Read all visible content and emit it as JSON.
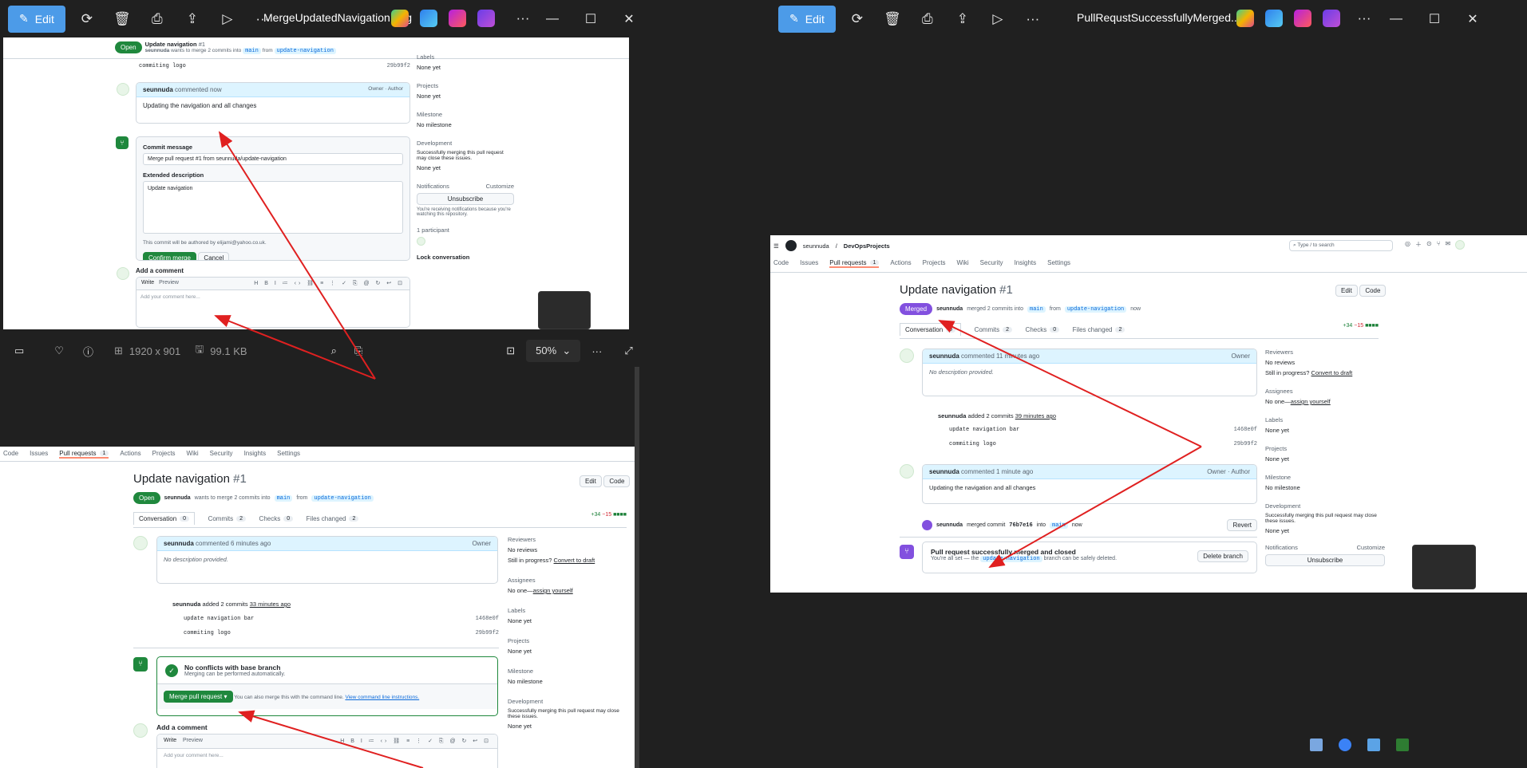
{
  "left_window": {
    "edit_label": "Edit",
    "filename": "MergeUpdatedNavigation.png",
    "dimensions": "1920 x 901",
    "filesize": "99.1 KB",
    "zoom": "50%"
  },
  "right_window": {
    "edit_label": "Edit",
    "filename": "PullRequstSuccessfullyMerged...."
  },
  "pr": {
    "title": "Update navigation",
    "number": "#1",
    "open_badge": "Open",
    "merged_badge": "Merged",
    "user": "seunnuda",
    "wants_text": "wants to merge 2 commits into",
    "merged_text": "merged 2 commits into",
    "base": "main",
    "from": "from",
    "head": "update-navigation",
    "now": "now",
    "repo": "DevOpsProjects",
    "search_placeholder": "Type / to search"
  },
  "nav": {
    "code": "Code",
    "issues": "Issues",
    "pulls": "Pull requests",
    "pulls_count": "1",
    "actions": "Actions",
    "projects": "Projects",
    "wiki": "Wiki",
    "security": "Security",
    "insights": "Insights",
    "settings": "Settings"
  },
  "tabs": {
    "conversation": "Conversation",
    "conv_count": "0",
    "commits": "Commits",
    "commits_count": "2",
    "checks": "Checks",
    "checks_count": "0",
    "files": "Files changed",
    "files_count": "2",
    "diff_add": "+34",
    "diff_del": "−15"
  },
  "buttons": {
    "edit": "Edit",
    "code": "Code",
    "confirm_merge": "Confirm merge",
    "cancel": "Cancel",
    "merge_pr": "Merge pull request",
    "delete_branch": "Delete branch",
    "revert": "Revert",
    "unsubscribe": "Unsubscribe",
    "customize": "Customize",
    "lock": "Lock conversation"
  },
  "comments": {
    "c1_time": "commented 6 minutes ago",
    "c1_time_b": "commented 11 minutes ago",
    "c1_body": "No description provided.",
    "owner": "Owner",
    "author": "Author",
    "added_commits": "added 2 commits",
    "added_time_a": "33 minutes ago",
    "added_time_b": "39 minutes ago",
    "commit1": "update navigation bar",
    "commit1_sha": "1468e0f",
    "commit2": "commiting logo",
    "commit2_sha": "29b99f2",
    "c2_time_now": "commented now",
    "c2_time_b": "commented 1 minute ago",
    "c2_body": "Updating the navigation and all changes",
    "merged_event": "merged commit",
    "merged_sha": "76b7e16",
    "into": "into",
    "merged_when": "now"
  },
  "merge_form": {
    "commit_msg_label": "Commit message",
    "commit_msg": "Merge pull request #1 from seunnuda/update-navigation",
    "ext_desc_label": "Extended description",
    "ext_desc": "Update navigation",
    "author_note": "This commit will be authored by elijami@yahoo.co.uk."
  },
  "merge_box": {
    "title": "No conflicts with base branch",
    "sub": "Merging can be performed automatically.",
    "also": "You can also merge this with the command line.",
    "cmd_link": "View command line instructions."
  },
  "merged_box": {
    "title": "Pull request successfully merged and closed",
    "sub_pre": "You're all set — the",
    "sub_post": "branch can be safely deleted."
  },
  "add_comment": {
    "title": "Add a comment",
    "write": "Write",
    "preview": "Preview",
    "placeholder": "Add your comment here..."
  },
  "sidebar": {
    "reviewers": "Reviewers",
    "reviewers_val": "No reviews",
    "in_progress": "Still in progress?",
    "convert": "Convert to draft",
    "assignees": "Assignees",
    "assignees_val": "No one—",
    "assign_self": "assign yourself",
    "labels": "Labels",
    "none_yet": "None yet",
    "projects": "Projects",
    "milestone": "Milestone",
    "milestone_val": "No milestone",
    "development": "Development",
    "dev_text": "Successfully merging this pull request may close these issues.",
    "notifications": "Notifications",
    "notif_text": "You're receiving notifications because you're watching this repository.",
    "participants": "1 participant"
  },
  "colors": {
    "arrow": "#e02020",
    "green": "#1f883d",
    "purple": "#8250df",
    "accent": "#4c9be8"
  }
}
